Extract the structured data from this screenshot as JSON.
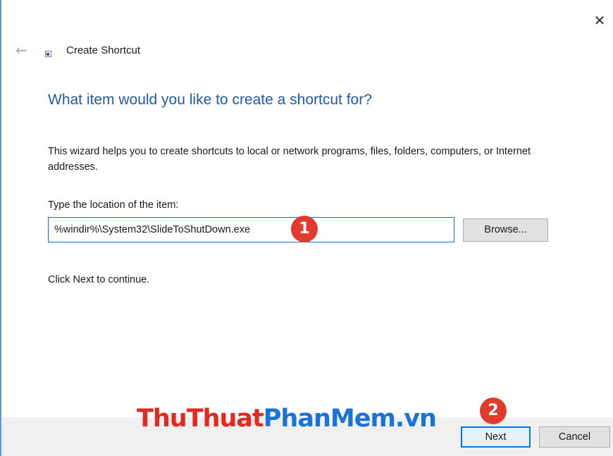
{
  "window": {
    "title": "Create Shortcut",
    "close_icon": "close-icon",
    "back_icon": "back-arrow-icon",
    "title_icon": "shortcut-icon"
  },
  "wizard": {
    "heading": "What item would you like to create a shortcut for?",
    "description": "This wizard helps you to create shortcuts to local or network programs, files, folders, computers, or Internet addresses.",
    "field_label": "Type the location of the item:",
    "location_value": "%windir%\\System32\\SlideToShutDown.exe",
    "browse_label": "Browse...",
    "continue_text": "Click Next to continue."
  },
  "annotations": {
    "step1": "1",
    "step2": "2"
  },
  "watermark": {
    "part1": "ThuThuat",
    "part2": "PhanMem",
    "part3": ".vn"
  },
  "footer": {
    "next_label": "Next",
    "cancel_label": "Cancel"
  },
  "colors": {
    "heading": "#1f5aa6",
    "accent": "#0078d7",
    "badge": "#e23b2c",
    "watermark_red": "#e02a20",
    "watermark_blue": "#1a73d9"
  }
}
